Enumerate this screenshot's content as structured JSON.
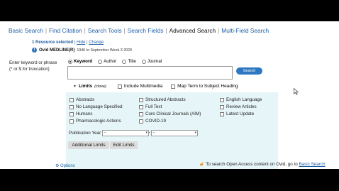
{
  "nav": {
    "tabs": [
      "Basic Search",
      "Find Citation",
      "Search Tools",
      "Search Fields",
      "Advanced Search",
      "Multi-Field Search"
    ],
    "active": "Advanced Search"
  },
  "resources": {
    "selected": "1 Resource selected",
    "hide": "Hide",
    "change": "Change"
  },
  "database": {
    "name": "Ovid MEDLINE(R)",
    "coverage": "1946 to September Week 3 2020"
  },
  "search": {
    "label_line1": "Enter keyword or phrase",
    "label_line2": "(* or $ for truncation)",
    "radio": [
      "Keyword",
      "Author",
      "Title",
      "Journal"
    ],
    "selected_radio": "Keyword",
    "input_value": "",
    "button": "Search"
  },
  "limits": {
    "title": "Limits",
    "close": "(close)",
    "include_multimedia": "Include Multimedia",
    "map_term": "Map Term to Subject Heading",
    "col1": [
      "Abstracts",
      "No Language Specified",
      "Humans",
      "Pharmacologic Actions"
    ],
    "col2": [
      "Structured Abstracts",
      "Full Text",
      "Core Clinical Journals (AIM)",
      "COVID-19"
    ],
    "col3": [
      "English Language",
      "Review Articles",
      "Latest Update"
    ],
    "publication_year_label": "Publication Year",
    "year_from": "-",
    "year_to": "-",
    "year_sep": "-",
    "additional_limits": "Additional Limits",
    "edit_limits": "Edit Limits"
  },
  "footer": {
    "options": "Options",
    "open_access_text": "To search Open Access content on Ovid, go to",
    "open_access_link": "Basic Search"
  },
  "icons": [
    "info-icon",
    "lock-icon",
    "mouse-cursor-icon"
  ],
  "colors": {
    "link": "#1d5fa8",
    "search_button": "#2e78c2",
    "limits_panel": "#e6f5f8",
    "lock": "#e08a1c"
  }
}
